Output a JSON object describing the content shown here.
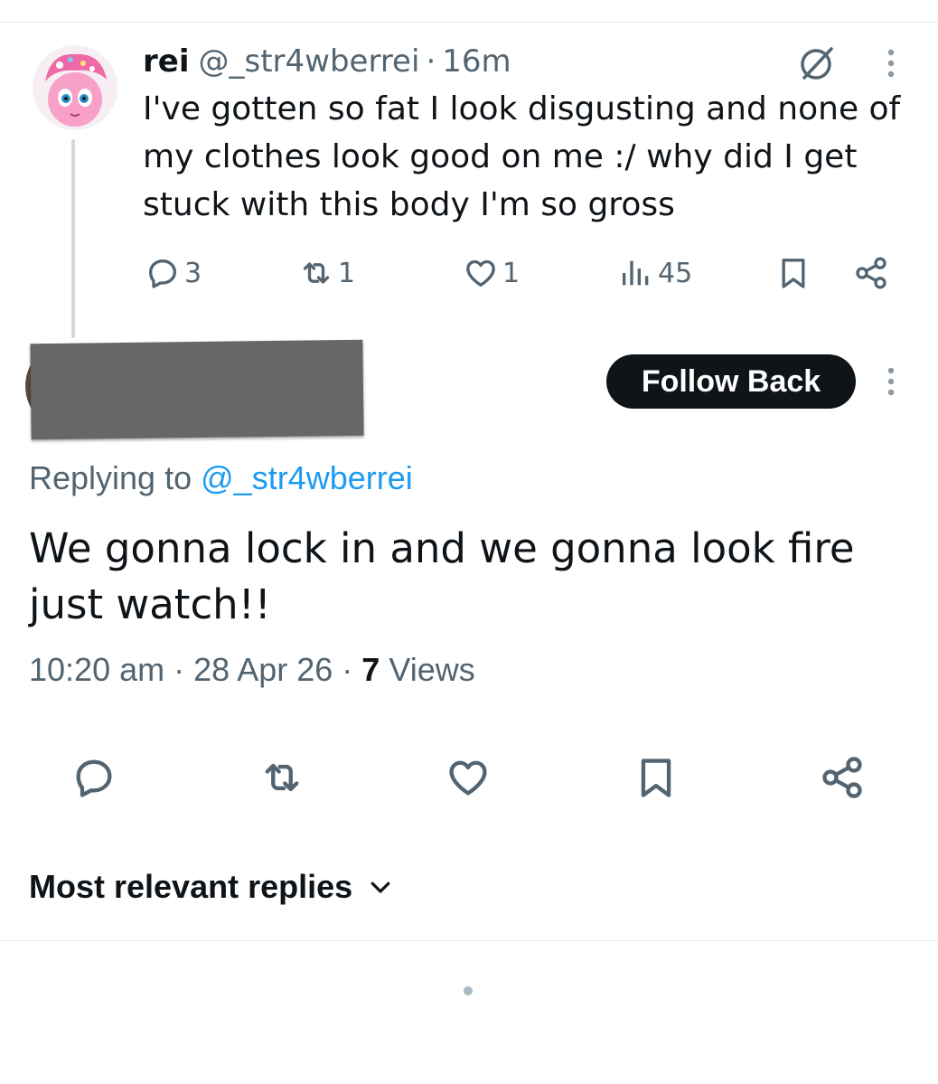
{
  "parent_tweet": {
    "display_name": "rei",
    "handle": "@_str4wberrei",
    "separator": "·",
    "time": "16m",
    "text": "I've gotten so fat I look disgusting and none of my clothes look good on me :/ why did I get stuck with this body I'm so gross",
    "replies": "3",
    "reposts": "1",
    "likes": "1",
    "views": "45"
  },
  "reply": {
    "follow_button": "Follow Back",
    "replying_prefix": "Replying to",
    "replying_handle": "@_str4wberrei",
    "text": "We gonna lock in and we gonna look fire just watch!!",
    "time": "10:20 am",
    "date": "28 Apr 26",
    "separator": "·",
    "views_count": "7",
    "views_label": "Views"
  },
  "sort": {
    "label": "Most relevant replies"
  },
  "icons": {
    "parent_actions": [
      "reply-icon",
      "repost-icon",
      "like-icon",
      "views-icon",
      "bookmark-icon",
      "share-icon"
    ],
    "reply_actions": [
      "reply-icon",
      "repost-icon",
      "like-icon",
      "bookmark-icon",
      "share-icon"
    ],
    "header": [
      "grok-icon",
      "more-icon"
    ]
  },
  "colors": {
    "text_primary": "#0f1419",
    "text_secondary": "#536471",
    "link": "#1d9bf0",
    "button_bg": "#0f1419",
    "redaction": "#666769"
  }
}
